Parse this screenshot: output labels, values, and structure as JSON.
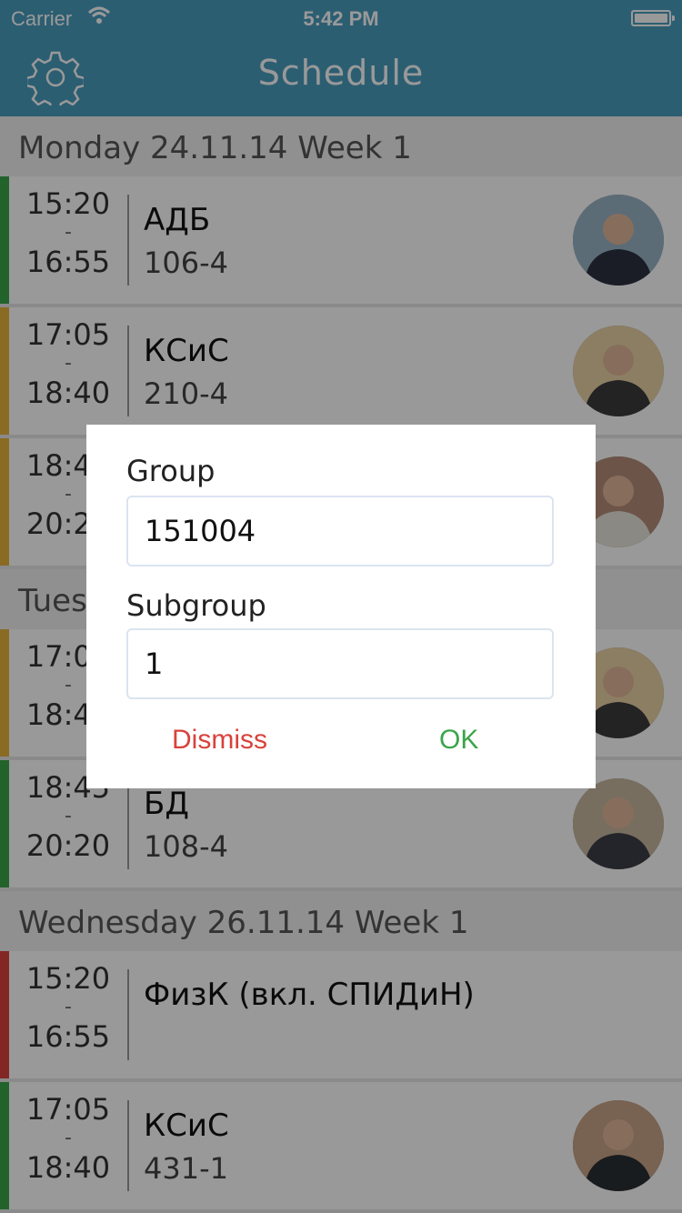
{
  "status_bar": {
    "carrier": "Carrier",
    "time": "5:42 PM"
  },
  "nav": {
    "title": "Schedule",
    "settings_icon": "gear-icon"
  },
  "days": [
    {
      "header": "Monday  24.11.14  Week  1",
      "lessons": [
        {
          "start": "15:20",
          "sep": "-",
          "end": "16:55",
          "subject": "АДБ",
          "room": "106-4",
          "color": "#3aa54a",
          "avatar_colors": [
            "#9ab4c6",
            "#2c3140"
          ]
        },
        {
          "start": "17:05",
          "sep": "-",
          "end": "18:40",
          "subject": "КСиС",
          "room": "210-4",
          "color": "#e7b33b",
          "avatar_colors": [
            "#e9d2a6",
            "#3b3b3b"
          ]
        },
        {
          "start": "18:45",
          "sep": "-",
          "end": "20:20",
          "subject": "",
          "room": "",
          "color": "#e7b33b",
          "avatar_colors": [
            "#b48c78",
            "#e8e4dd"
          ]
        }
      ]
    },
    {
      "header": "Tuesday  25.11.14  Week  1",
      "lessons": [
        {
          "start": "17:05",
          "sep": "-",
          "end": "18:40",
          "subject": "",
          "room": "",
          "color": "#e7b33b",
          "avatar_colors": [
            "#e9d2a6",
            "#3b3b3b"
          ]
        },
        {
          "start": "18:45",
          "sep": "-",
          "end": "20:20",
          "subject": "БД",
          "room": "108-4",
          "color": "#3aa54a",
          "avatar_colors": [
            "#c8b8a0",
            "#3d3f46"
          ]
        }
      ]
    },
    {
      "header": "Wednesday  26.11.14  Week  1",
      "lessons": [
        {
          "start": "15:20",
          "sep": "-",
          "end": "16:55",
          "subject": "ФизК (вкл. СПИДиН)",
          "room": "",
          "color": "#d9423b",
          "avatar_colors": null
        },
        {
          "start": "17:05",
          "sep": "-",
          "end": "18:40",
          "subject": "КСиС",
          "room": "431-1",
          "color": "#3aa54a",
          "avatar_colors": [
            "#c9a487",
            "#2b2f33"
          ]
        }
      ]
    }
  ],
  "dialog": {
    "group_label": "Group",
    "group_value": "151004",
    "subgroup_label": "Subgroup",
    "subgroup_value": "1",
    "dismiss_label": "Dismiss",
    "ok_label": "OK",
    "dismiss_color": "#d9423b",
    "ok_color": "#3aa54a"
  }
}
